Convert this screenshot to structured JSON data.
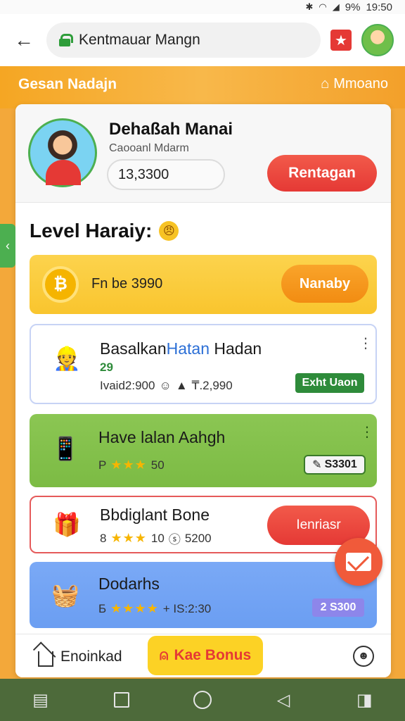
{
  "status_bar": {
    "battery": "9%",
    "time": "19:50",
    "icons": [
      "bluetooth-icon",
      "wifi-icon",
      "signal-icon"
    ]
  },
  "browser": {
    "url": "Kentmauar Mangn",
    "back_icon": "arrow-left-icon",
    "badge_icon": "star-icon"
  },
  "banner": {
    "left_text": "Gesan Nadajn",
    "right_text": "Mmoano"
  },
  "profile": {
    "name": "Dehaßah Manai",
    "subtitle": "Caooanl Mdarm",
    "points": "13,3300",
    "button_label": "Rentagan"
  },
  "level": {
    "title": "Level Haraiy:",
    "emoji": "😠"
  },
  "yellow_bar": {
    "text": "Fn be 3990",
    "button_label": "Nanaby",
    "icon": "₿"
  },
  "side_tab": {
    "icon": "‹"
  },
  "tasks": [
    {
      "title_a": "Basalkan",
      "title_b": "Hatan",
      "title_c": " Hadan",
      "sub": "29",
      "meta": "Ivaid2:900",
      "meta_extra": "₸.2,990",
      "badge": "Exht Uaon",
      "accent": "#2c6fd6"
    },
    {
      "title": "Have lalan Aahgh",
      "meta_prefix": "P",
      "stars": "★★★",
      "meta_value": "50",
      "badge": "S3301"
    },
    {
      "title": "Bbdiglant Bone",
      "meta_prefix": "8",
      "stars": "★★★",
      "meta_value": "10",
      "meta_extra": "5200",
      "button_label": "Ienriasr"
    },
    {
      "title": "Dodarhs",
      "meta_prefix": "Б",
      "stars": "★★★★",
      "meta_value": "+ IS:2:30",
      "badge": "2 S300"
    }
  ],
  "bottom_bar": {
    "left_label": "Enoinkad",
    "bonus_label": "Kae Bonus"
  },
  "colors": {
    "orange": "#f5a623",
    "red": "#e53935",
    "green": "#7cbb44",
    "blue": "#6b9ef2",
    "yellow": "#fcd34d"
  }
}
